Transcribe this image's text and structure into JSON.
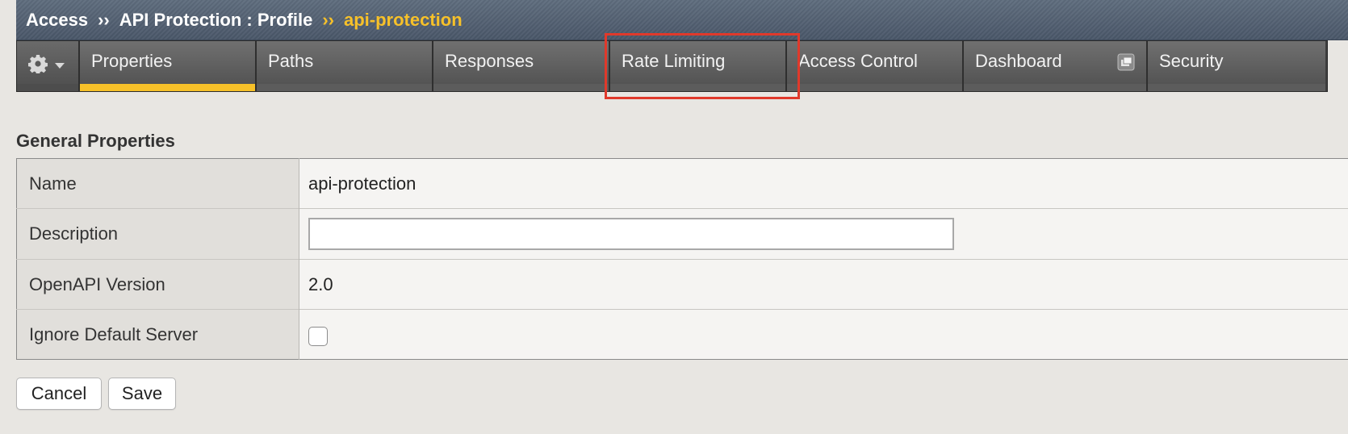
{
  "breadcrumb": {
    "items": [
      "Access",
      "API Protection : Profile"
    ],
    "separator": "››",
    "current": "api-protection"
  },
  "tabs": [
    {
      "label": "Properties",
      "active": true
    },
    {
      "label": "Paths",
      "active": false
    },
    {
      "label": "Responses",
      "active": false
    },
    {
      "label": "Rate Limiting",
      "active": false,
      "highlighted": true
    },
    {
      "label": "Access Control",
      "active": false
    },
    {
      "label": "Dashboard",
      "active": false
    },
    {
      "label": "Security",
      "active": false
    }
  ],
  "icons": {
    "gear": "gear-icon",
    "caret": "chevron-down-icon",
    "popout": "popout-window-icon"
  },
  "section": {
    "title": "General Properties"
  },
  "properties": {
    "name_label": "Name",
    "name_value": "api-protection",
    "description_label": "Description",
    "description_value": "",
    "openapi_label": "OpenAPI Version",
    "openapi_value": "2.0",
    "ignore_label": "Ignore Default Server",
    "ignore_checked": false
  },
  "buttons": {
    "cancel": "Cancel",
    "save": "Save"
  },
  "colors": {
    "accent": "#f7c129",
    "highlight": "#e0392b",
    "header_bg": "#5f6d7e",
    "tab_bg": "#5a5a5a"
  }
}
